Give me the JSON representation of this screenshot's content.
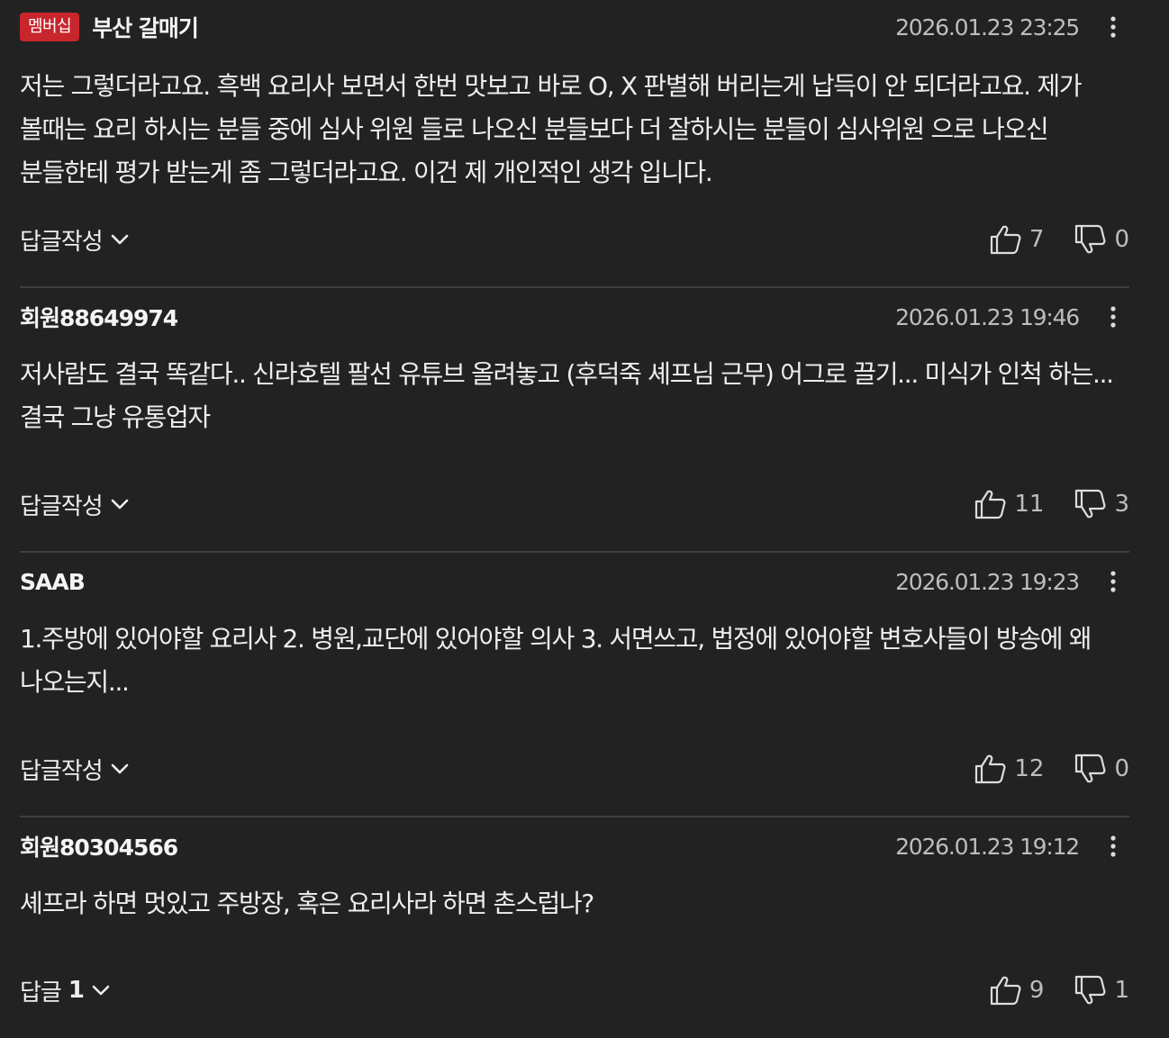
{
  "comments": [
    {
      "badge": "멤버십",
      "author": "부산 갈매기",
      "date": "2026.01.23 23:25",
      "text": "저는 그렇더라고요. 흑백 요리사 보면서 한번 맛보고 바로 O, X 판별해 버리는게 납득이 안 되더라고요. 제가 볼때는 요리 하시는 분들 중에 심사 위원 들로 나오신 분들보다 더 잘하시는 분들이 심사위원 으로 나오신 분들한테 평가 받는게 좀 그렇더라고요. 이건 제 개인적인 생각 입니다.",
      "reply_label": "답글작성",
      "reply_count": "",
      "likes": "7",
      "dislikes": "0"
    },
    {
      "badge": "",
      "author": "회원88649974",
      "date": "2026.01.23 19:46",
      "text": "저사람도 결국 똑같다.. 신라호텔 팔선 유튜브 올려놓고 (후덕죽 셰프님 근무) 어그로 끌기... 미식가 인척 하는... 결국 그냥 유통업자",
      "reply_label": "답글작성",
      "reply_count": "",
      "likes": "11",
      "dislikes": "3"
    },
    {
      "badge": "",
      "author": "SAAB",
      "date": "2026.01.23 19:23",
      "text": "1.주방에 있어야할 요리사 2. 병원,교단에 있어야할 의사 3. 서면쓰고, 법정에 있어야할 변호사들이 방송에 왜 나오는지...",
      "reply_label": "답글작성",
      "reply_count": "",
      "likes": "12",
      "dislikes": "0"
    },
    {
      "badge": "",
      "author": "회원80304566",
      "date": "2026.01.23 19:12",
      "text": "셰프라 하면 멋있고 주방장, 혹은 요리사라 하면 촌스럽나?",
      "reply_label": "답글",
      "reply_count": "1",
      "likes": "9",
      "dislikes": "1"
    }
  ],
  "icons": {
    "more": "more-vertical-icon",
    "like": "thumbs-up-icon",
    "dislike": "thumbs-down-icon",
    "chevron": "chevron-down-icon"
  },
  "colors": {
    "background": "#222222",
    "badge": "#c9252c",
    "divider": "#3f3f3f",
    "text": "#eeeeee",
    "muted": "#bdbdbd"
  }
}
